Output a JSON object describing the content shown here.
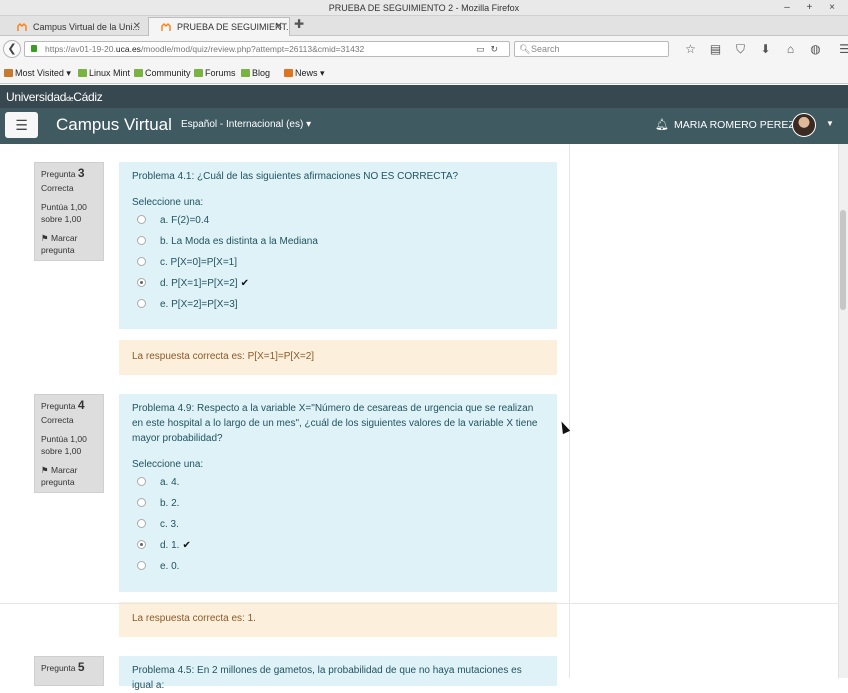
{
  "window": {
    "title": "PRUEBA DE SEGUIMIENTO 2 - Mozilla Firefox",
    "controls": "– + ×"
  },
  "tabs": [
    {
      "label": "Campus Virtual de la Uni..."
    },
    {
      "label": "PRUEBA DE SEGUIMIENT..."
    }
  ],
  "url": {
    "prefix": "https://av01-19-20.",
    "domain": "uca.es",
    "path": "/moodle/mod/quiz/review.php?attempt=26113&cmid=31432"
  },
  "search": {
    "placeholder": "Search"
  },
  "bookmarks": [
    {
      "label": "Most Visited ▾",
      "color": "#c77a2e"
    },
    {
      "label": "Linux Mint",
      "color": "#7ab33f"
    },
    {
      "label": "Community",
      "color": "#7ab33f"
    },
    {
      "label": "Forums",
      "color": "#7ab33f"
    },
    {
      "label": "Blog",
      "color": "#7ab33f"
    },
    {
      "label": "News ▾",
      "color": "#e2731e"
    }
  ],
  "uca": {
    "logo_a": "Universidad",
    "logo_b": "de",
    "logo_c": "Cádiz"
  },
  "moodle": {
    "brand": "Campus Virtual",
    "language": "Español - Internacional (es) ▾",
    "user": "MARIA ROMERO PEREZ"
  },
  "questions": [
    {
      "label": "Pregunta",
      "number": "3",
      "state": "Correcta",
      "grade_a": "Puntúa 1,00",
      "grade_b": "sobre 1,00",
      "flag": "Marcar pregunta",
      "text": "Problema 4.1: ¿Cuál de las siguientes afirmaciones NO ES CORRECTA?",
      "prompt": "Seleccione una:",
      "answers": [
        {
          "text": "a. F(2)=0.4"
        },
        {
          "text": "b. La Moda es distinta a la Mediana"
        },
        {
          "text": "c. P[X=0]=P[X=1]"
        },
        {
          "text": "d. P[X=1]=P[X=2]"
        },
        {
          "text": "e. P[X=2]=P[X=3]"
        }
      ],
      "feedback": "La respuesta correcta es: P[X=1]=P[X=2]"
    },
    {
      "label": "Pregunta",
      "number": "4",
      "state": "Correcta",
      "grade_a": "Puntúa 1,00",
      "grade_b": "sobre 1,00",
      "flag": "Marcar pregunta",
      "text": "Problema 4.9: Respecto a la variable X=\"Número de cesareas de urgencia que se realizan en este hospital a lo largo de un mes\", ¿cuál de los siguientes valores de la variable X tiene mayor probabilidad?",
      "prompt": "Seleccione una:",
      "answers": [
        {
          "text": "a. 4."
        },
        {
          "text": "b. 2."
        },
        {
          "text": "c. 3."
        },
        {
          "text": "d. 1."
        },
        {
          "text": "e. 0."
        }
      ],
      "feedback": "La respuesta correcta es: 1."
    },
    {
      "label": "Pregunta",
      "number": "5",
      "text": "Problema 4.5: En 2 millones de gametos, la probabilidad de que no haya mutaciones es igual a:"
    }
  ],
  "tick": "✔"
}
